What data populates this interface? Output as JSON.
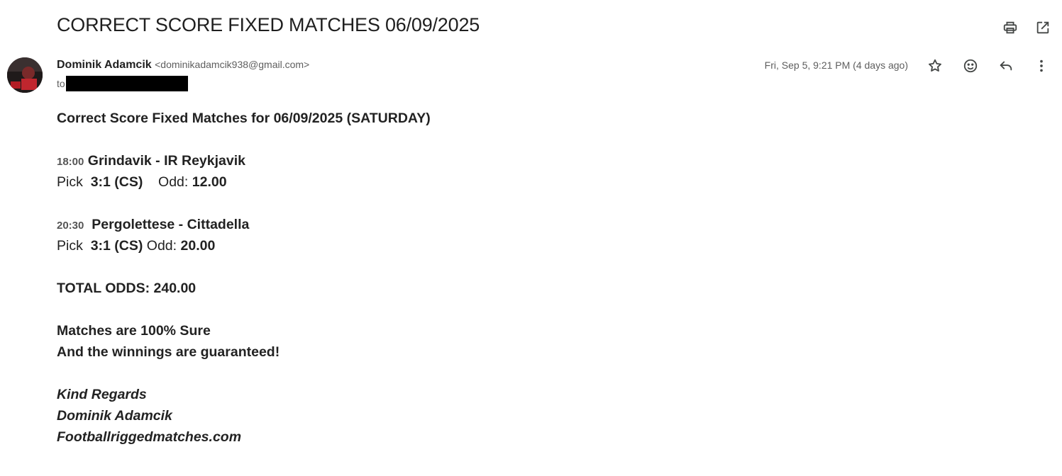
{
  "email": {
    "subject": "CORRECT SCORE FIXED MATCHES 06/09/2025",
    "sender_name": "Dominik Adamcik",
    "sender_email": "<dominikadamcik938@gmail.com>",
    "to_label": "to",
    "date": "Fri, Sep 5, 9:21 PM (4 days ago)"
  },
  "body": {
    "heading": "Correct Score Fixed Matches for 06/09/2025 (SATURDAY)",
    "matches": [
      {
        "time": "18:00",
        "teams": "Grindavik - IR Reykjavik",
        "pick_label": "Pick",
        "pick": "3:1 (CS)",
        "odd_label": "Odd:",
        "odd": "12.00"
      },
      {
        "time": "20:30",
        "teams": "Pergolettese - Cittadella",
        "pick_label": "Pick",
        "pick": "3:1 (CS)",
        "odd_label": "Odd:",
        "odd": "20.00"
      }
    ],
    "total": "TOTAL ODDS: 240.00",
    "sure": "Matches are 100% Sure",
    "guarantee": "And the winnings are guaranteed!",
    "sign1": "Kind Regards",
    "sign2": "Dominik Adamcik",
    "sign3": "Footballriggedmatches.com"
  },
  "icons": {
    "print": "print-icon",
    "open_new_window": "open-in-new-icon",
    "star": "star-icon",
    "emoji": "emoji-icon",
    "reply": "reply-icon",
    "more": "more-vert-icon"
  }
}
